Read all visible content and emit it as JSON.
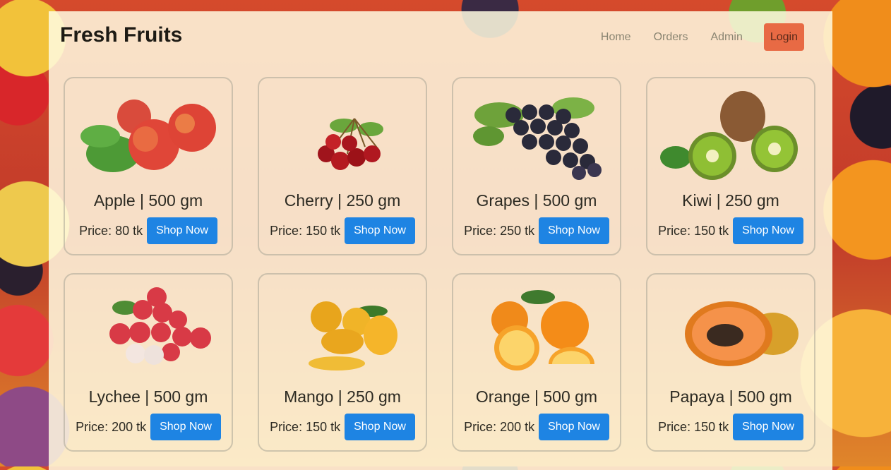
{
  "header": {
    "brand": "Fresh Fruits",
    "nav": [
      "Home",
      "Orders",
      "Admin"
    ],
    "login_label": "Login"
  },
  "products": [
    {
      "name": "Apple | 500 gm",
      "price": "Price: 80 tk",
      "cta": "Shop Now",
      "image": "apple-image"
    },
    {
      "name": "Cherry | 250 gm",
      "price": "Price: 150 tk",
      "cta": "Shop Now",
      "image": "cherry-image"
    },
    {
      "name": "Grapes | 500 gm",
      "price": "Price: 250 tk",
      "cta": "Shop Now",
      "image": "grapes-image"
    },
    {
      "name": "Kiwi | 250 gm",
      "price": "Price: 150 tk",
      "cta": "Shop Now",
      "image": "kiwi-image"
    },
    {
      "name": "Lychee | 500 gm",
      "price": "Price: 200 tk",
      "cta": "Shop Now",
      "image": "lychee-image"
    },
    {
      "name": "Mango | 250 gm",
      "price": "Price: 150 tk",
      "cta": "Shop Now",
      "image": "mango-image"
    },
    {
      "name": "Orange | 500 gm",
      "price": "Price: 200 tk",
      "cta": "Shop Now",
      "image": "orange-image"
    },
    {
      "name": "Papaya | 500 gm",
      "price": "Price: 150 tk",
      "cta": "Shop Now",
      "image": "papaya-image"
    }
  ],
  "colors": {
    "accent_button": "#1e84e3",
    "login_button": "#e86a44"
  }
}
